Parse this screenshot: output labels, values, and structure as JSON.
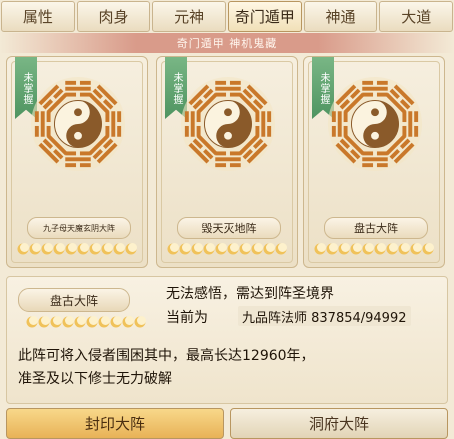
{
  "tabs": [
    "属性",
    "肉身",
    "元神",
    "奇门遁甲",
    "神通",
    "大道"
  ],
  "active_tab": 3,
  "subtitle": "奇门遁甲 神机鬼藏",
  "cards": [
    {
      "status": "未掌握",
      "name": "九子母天魔玄阴大阵",
      "stars_filled": 0,
      "stars_total": 10
    },
    {
      "status": "未掌握",
      "name": "毁天灭地阵",
      "stars_filled": 0,
      "stars_total": 10
    },
    {
      "status": "未掌握",
      "name": "盘古大阵",
      "stars_filled": 0,
      "stars_total": 10
    }
  ],
  "detail": {
    "name": "盘古大阵",
    "stars_filled": 0,
    "stars_total": 10,
    "line1": "无法感悟，需达到阵圣境界",
    "line2_label": "当前为",
    "rank": "九品阵法师 837854/94992",
    "desc1": "此阵可将入侵者围困其中，最高长达12960年，",
    "desc2": "准圣及以下修士无力破解"
  },
  "bottom_tabs": [
    "封印大阵",
    "洞府大阵"
  ],
  "colors": {
    "active_tab": "#e8b257",
    "ribbon": "#4e9460",
    "moon": "#f0c25a"
  }
}
